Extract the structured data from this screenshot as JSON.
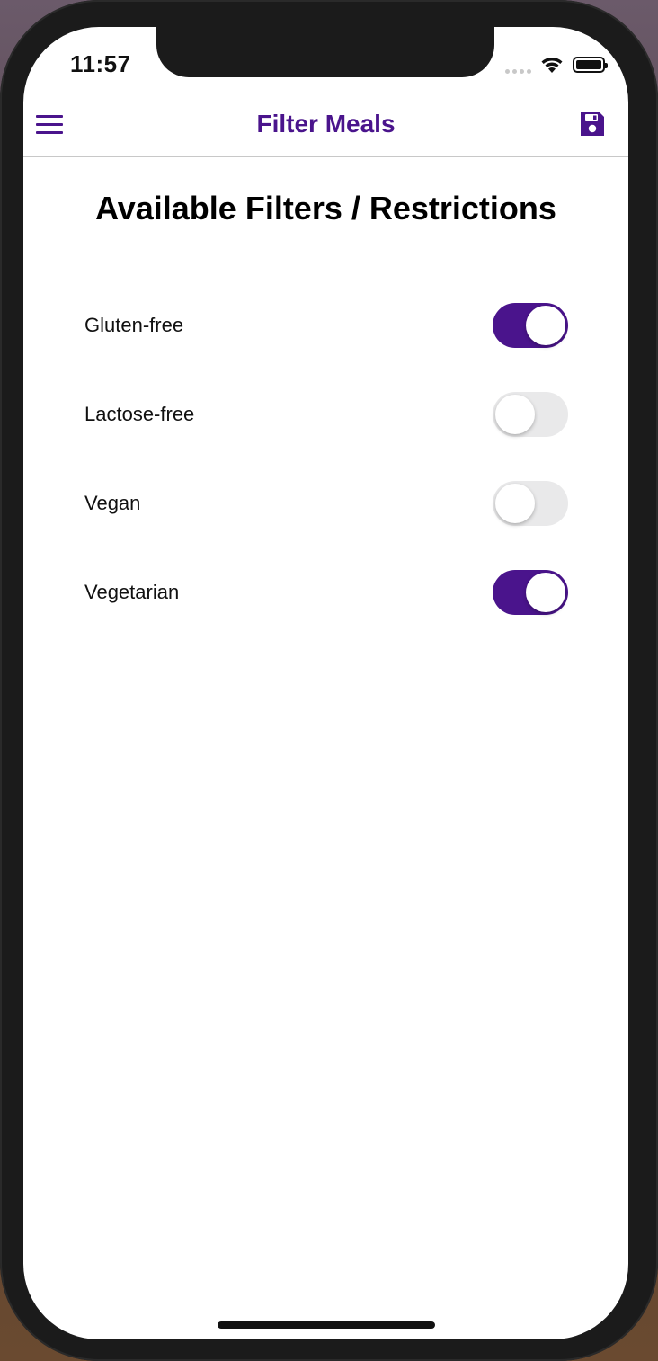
{
  "status_bar": {
    "time": "11:57"
  },
  "navbar": {
    "title": "Filter Meals",
    "menu_icon": "hamburger-menu-icon",
    "save_icon": "save-floppy-icon",
    "accent_color": "#4a148c"
  },
  "content": {
    "heading": "Available Filters / Restrictions",
    "filters": [
      {
        "label": "Gluten-free",
        "enabled": true
      },
      {
        "label": "Lactose-free",
        "enabled": false
      },
      {
        "label": "Vegan",
        "enabled": false
      },
      {
        "label": "Vegetarian",
        "enabled": true
      }
    ]
  }
}
